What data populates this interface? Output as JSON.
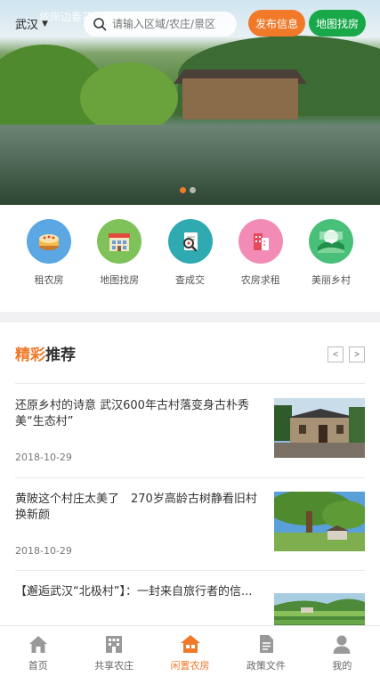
{
  "header": {
    "city": "武汉",
    "search_placeholder": "请输入区域/农庄/景区",
    "publish_button": "发布信息",
    "map_button": "地图找房"
  },
  "banner": {
    "poem": "依岸边春花，黄鸡不懈叹",
    "slide_count": 2,
    "active_slide": 1
  },
  "categories": [
    {
      "label": "租农房",
      "icon": "cake-icon",
      "color": "#5aa7e3"
    },
    {
      "label": "地图找房",
      "icon": "store-icon",
      "color": "#7fc25a"
    },
    {
      "label": "查成交",
      "icon": "magnifier-document-icon",
      "color": "#2eaab0"
    },
    {
      "label": "农房求租",
      "icon": "buildings-icon",
      "color": "#f28cb6"
    },
    {
      "label": "美丽乡村",
      "icon": "landscape-icon",
      "color": "#49c07a"
    }
  ],
  "recommend": {
    "title_highlight": "精彩",
    "title_rest": "推荐",
    "prev": "<",
    "next": ">",
    "items": [
      {
        "title": "还原乡村的诗意 武汉600年古村落变身古朴秀美“生态村”",
        "date": "2018-10-29",
        "thumb": "village-house-photo"
      },
      {
        "title": "黄陂这个村庄太美了　270岁高龄古树静看旧村换新颜",
        "date": "2018-10-29",
        "thumb": "old-tree-photo"
      },
      {
        "title": "【邂逅武汉“北极村”】：一封来自旅行者的信...",
        "date": "",
        "thumb": "terraced-fields-photo"
      }
    ]
  },
  "tabbar": {
    "tabs": [
      {
        "label": "首页",
        "icon": "home-icon",
        "active": false
      },
      {
        "label": "共享农庄",
        "icon": "farmhouse-icon",
        "active": false
      },
      {
        "label": "闲置农房",
        "icon": "house-icon",
        "active": true
      },
      {
        "label": "政策文件",
        "icon": "document-icon",
        "active": false
      },
      {
        "label": "我的",
        "icon": "user-icon",
        "active": false
      }
    ]
  },
  "colors": {
    "accent": "#f07a2a",
    "green": "#18a84a"
  }
}
